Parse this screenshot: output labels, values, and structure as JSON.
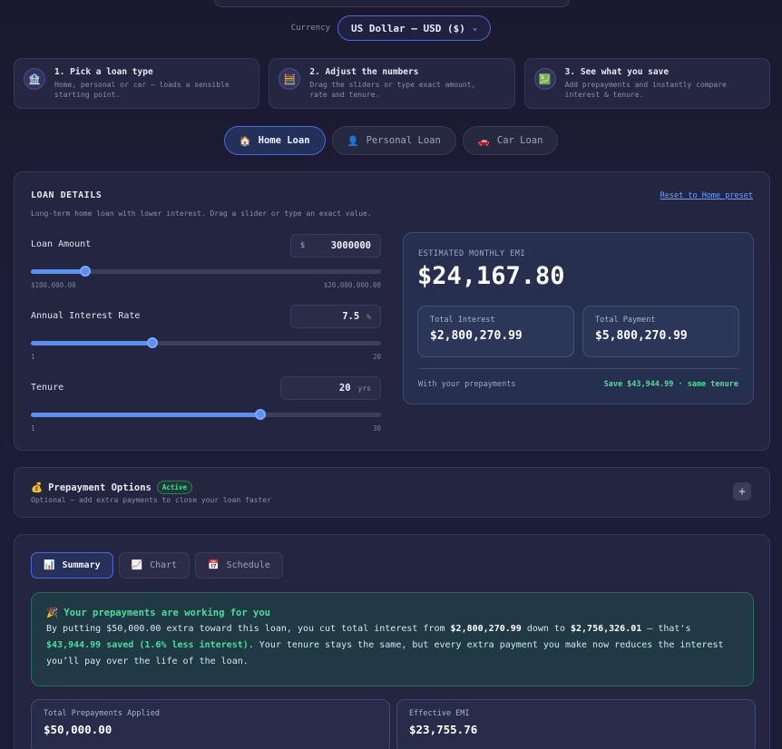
{
  "currency": {
    "label": "Currency",
    "selected": "US Dollar — USD ($)"
  },
  "steps": [
    {
      "icon": "🏦",
      "title": "1. Pick a loan type",
      "desc1": "Home, personal or car — loads a sensible",
      "desc2": "starting point."
    },
    {
      "icon": "🧮",
      "title": "2. Adjust the numbers",
      "desc1": "Drag the sliders or type exact amount,",
      "desc2": "rate and tenure."
    },
    {
      "icon": "💹",
      "title": "3. See what you save",
      "desc1": "Add prepayments and instantly compare",
      "desc2": "interest & tenure."
    }
  ],
  "loan_tabs": [
    {
      "icon": "🏠",
      "label": "Home Loan",
      "active": true
    },
    {
      "icon": "👤",
      "label": "Personal Loan",
      "active": false
    },
    {
      "icon": "🚗",
      "label": "Car Loan",
      "active": false
    }
  ],
  "loan_details": {
    "title": "LOAN DETAILS",
    "subtitle": "Long-term home loan with lower interest. Drag a slider or type an exact value.",
    "reset_label": "Reset to Home preset",
    "amount": {
      "label": "Loan Amount",
      "prefix": "$",
      "value": "3000000",
      "min_label": "$100,000.00",
      "max_label": "$20,000,000.00",
      "fraction": 0.155
    },
    "rate": {
      "label": "Annual Interest Rate",
      "value": "7.5",
      "suffix": "%",
      "min_label": "1",
      "max_label": "20",
      "fraction": 0.347
    },
    "tenure": {
      "label": "Tenure",
      "value": "20",
      "suffix": "yrs",
      "min_label": "1",
      "max_label": "30",
      "fraction": 0.655
    }
  },
  "emi": {
    "label": "ESTIMATED MONTHLY EMI",
    "value": "$24,167.80",
    "total_interest_label": "Total Interest",
    "total_interest": "$2,800,270.99",
    "total_payment_label": "Total Payment",
    "total_payment": "$5,800,270.99",
    "prepay_note": "With your prepayments",
    "save_note": "Save $43,944.99 · same tenure"
  },
  "prepayment": {
    "icon": "💰",
    "title": "Prepayment Options",
    "badge": "Active",
    "subtitle": "Optional — add extra payments to close your loan faster",
    "toggle": "+"
  },
  "results_tabs": [
    {
      "icon": "📊",
      "label": "Summary",
      "active": true
    },
    {
      "icon": "📈",
      "label": "Chart",
      "active": false
    },
    {
      "icon": "📅",
      "label": "Schedule",
      "active": false
    }
  ],
  "callout": {
    "icon": "🎉",
    "title": "Your prepayments are working for you",
    "t1": "By putting $50,000.00 extra toward this loan, you cut total interest from ",
    "b1": "$2,800,270.99",
    "t2": " down to ",
    "b2": "$2,756,326.01",
    "t3": " — that's ",
    "g1": "$43,944.99 saved (1.6% less interest)",
    "t4": ". Your tenure stays the same, but every extra payment you make now reduces the interest you’ll pay over the life of the loan."
  },
  "stats": [
    {
      "label": "Total Prepayments Applied",
      "value": "$50,000.00"
    },
    {
      "label": "Effective EMI",
      "value": "$23,755.76"
    }
  ]
}
